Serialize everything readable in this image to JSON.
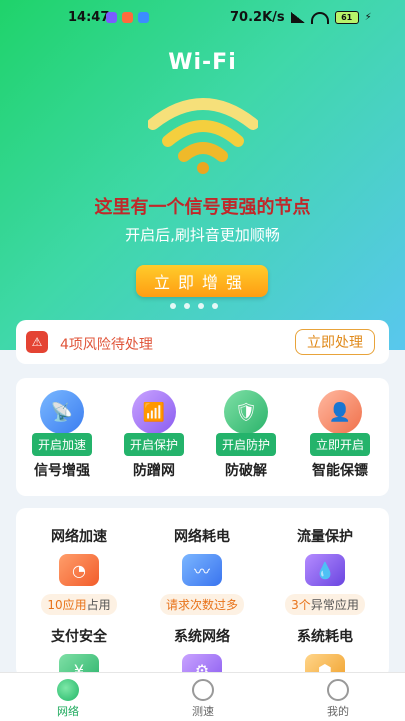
{
  "status_bar": {
    "time": "14:47",
    "speed": "70.2K/s",
    "battery": "61"
  },
  "hero": {
    "title": "Wi-Fi",
    "headline": "这里有一个信号更强的节点",
    "subtitle": "开启后,刷抖音更加顺畅",
    "boost_button": "立即增强"
  },
  "risk": {
    "text": "4项风险待处理",
    "button": "立即处理"
  },
  "features": [
    {
      "tag": "开启加速",
      "label": "信号增强",
      "icon": "satellite-dish-icon"
    },
    {
      "tag": "开启保护",
      "label": "防蹭网",
      "icon": "router-icon"
    },
    {
      "tag": "开启防护",
      "label": "防破解",
      "icon": "shield-icon"
    },
    {
      "tag": "立即开启",
      "label": "智能保镖",
      "icon": "bodyguard-icon"
    }
  ],
  "tools": [
    {
      "name": "网络加速",
      "status_highlight": "10应用",
      "status_rest": "占用",
      "icon": "speedometer-icon"
    },
    {
      "name": "网络耗电",
      "status_highlight": "请求次数过多",
      "status_rest": "",
      "icon": "monitor-icon"
    },
    {
      "name": "流量保护",
      "status_highlight": "3个",
      "status_rest": "异常应用",
      "icon": "flow-icon"
    },
    {
      "name": "支付安全",
      "icon": "yuan-icon"
    },
    {
      "name": "系统网络",
      "icon": "system-network-icon"
    },
    {
      "name": "系统耗电",
      "icon": "battery-cube-icon"
    }
  ],
  "nav": [
    {
      "label": "网络",
      "icon": "planet-icon"
    },
    {
      "label": "测速",
      "icon": "speed-test-icon"
    },
    {
      "label": "我的",
      "icon": "profile-icon"
    }
  ],
  "colors": {
    "hero_start": "#1fd36a",
    "hero_end": "#59c7ee",
    "accent_green": "#24b36b",
    "alert_red": "#c0282a",
    "orange": "#ff9d12"
  }
}
